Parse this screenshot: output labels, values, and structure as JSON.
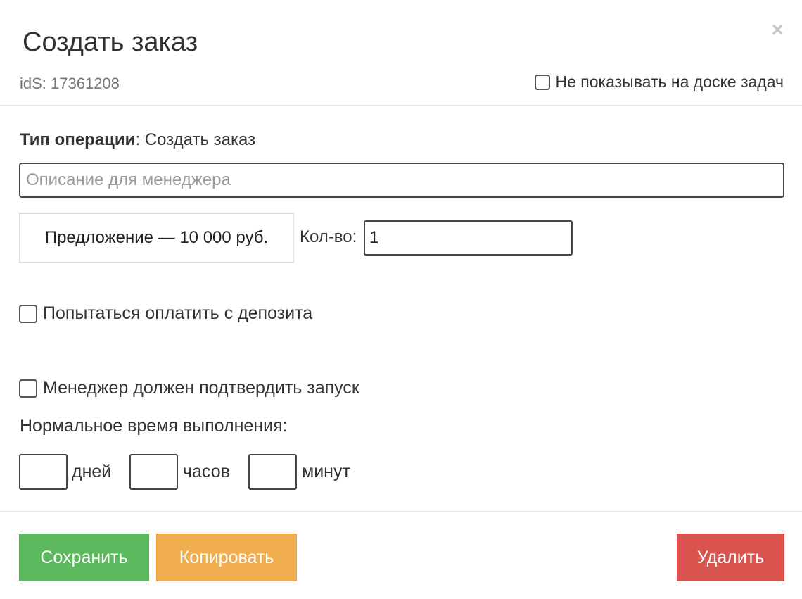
{
  "header": {
    "title": "Создать заказ",
    "close_symbol": "×",
    "ids_text": "idS: 17361208",
    "hide_board_label": "Не показывать на доске задач"
  },
  "form": {
    "operation_type_label": "Тип операции",
    "operation_type_value": ": Создать заказ",
    "description_placeholder": "Описание для менеджера",
    "description_value": "",
    "offer_text": "Предложение — 10 000 руб.",
    "quantity_label": "Кол-во:",
    "quantity_value": "1",
    "pay_from_deposit_label": "Попытаться оплатить с депозита",
    "manager_confirm_label": "Менеджер должен подтвердить запуск",
    "normal_time_label": "Нормальное время выполнения:",
    "days_label": "дней",
    "hours_label": "часов",
    "minutes_label": "минут",
    "days_value": "",
    "hours_value": "",
    "minutes_value": ""
  },
  "footer": {
    "save_label": "Сохранить",
    "copy_label": "Копировать",
    "delete_label": "Удалить"
  },
  "colors": {
    "save": "#5cb85c",
    "copy": "#f0ad4e",
    "delete": "#d9534f"
  }
}
